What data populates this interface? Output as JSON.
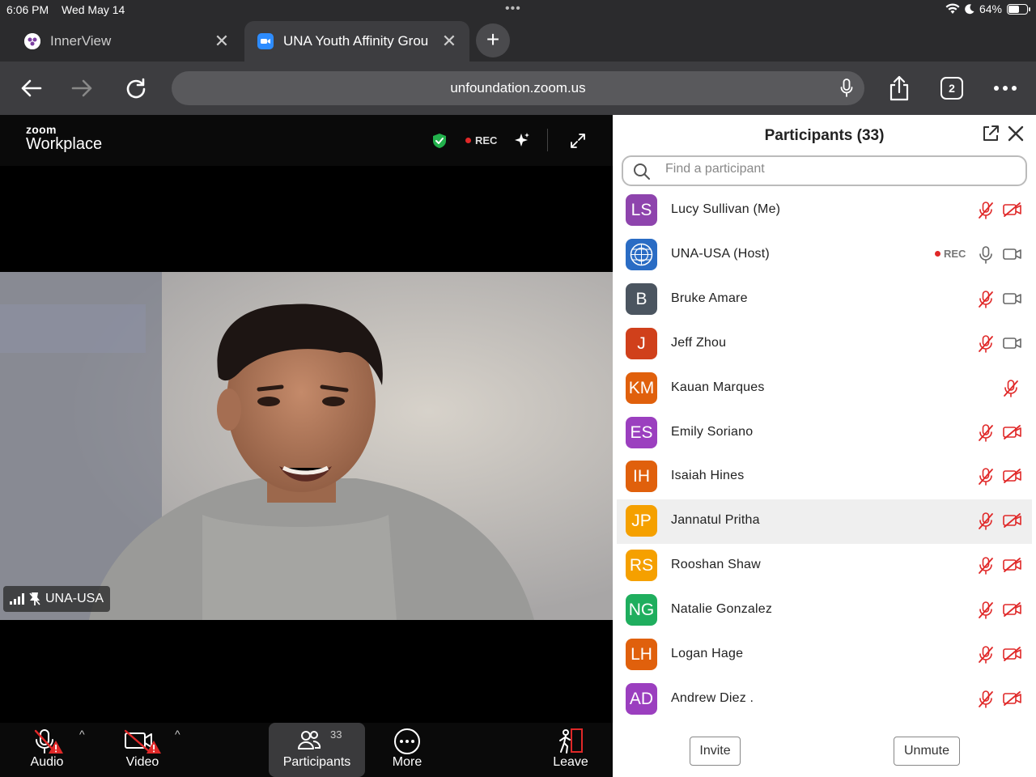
{
  "status_bar": {
    "time": "6:06 PM",
    "date": "Wed May 14",
    "battery": "64%",
    "battery_level": 0.64
  },
  "tabs": [
    {
      "title": "InnerView",
      "active": false
    },
    {
      "title": "UNA Youth Affinity Grou",
      "active": true
    }
  ],
  "toolbar": {
    "url": "unfoundation.zoom.us",
    "tab_count": "2"
  },
  "zoom": {
    "logo_small": "zoom",
    "logo_big": "Workplace",
    "rec_label": "REC",
    "speaker_name": "UNA-USA",
    "controls": {
      "audio": "Audio",
      "video": "Video",
      "participants": "Participants",
      "participants_count": "33",
      "more": "More",
      "leave": "Leave"
    }
  },
  "panel": {
    "title": "Participants (33)",
    "search_placeholder": "Find a participant",
    "invite": "Invite",
    "unmute": "Unmute",
    "rec_label": "REC",
    "participants": [
      {
        "initials": "LS",
        "name": "Lucy Sullivan (Me)",
        "color": "#8e44ad",
        "mic": "muted",
        "cam": "off"
      },
      {
        "initials": "",
        "name": "UNA-USA (Host)",
        "color": "#2a6cc4",
        "mic": "on",
        "cam": "on",
        "rec": true,
        "logo": true
      },
      {
        "initials": "B",
        "name": "Bruke Amare",
        "color": "#4b5560",
        "mic": "muted",
        "cam": "on"
      },
      {
        "initials": "J",
        "name": "Jeff Zhou",
        "color": "#d0401b",
        "mic": "muted",
        "cam": "on"
      },
      {
        "initials": "KM",
        "name": "Kauan Marques",
        "color": "#e0600c",
        "mic": "muted",
        "cam": "none"
      },
      {
        "initials": "ES",
        "name": "Emily Soriano",
        "color": "#9b3fbf",
        "mic": "muted",
        "cam": "off"
      },
      {
        "initials": "IH",
        "name": "Isaiah Hines",
        "color": "#e0600c",
        "mic": "muted",
        "cam": "off"
      },
      {
        "initials": "JP",
        "name": "Jannatul Pritha",
        "color": "#f5a000",
        "mic": "muted",
        "cam": "off",
        "highlight": true
      },
      {
        "initials": "RS",
        "name": "Rooshan Shaw",
        "color": "#f5a000",
        "mic": "muted",
        "cam": "off"
      },
      {
        "initials": "NG",
        "name": "Natalie Gonzalez",
        "color": "#1fae5e",
        "mic": "muted",
        "cam": "off"
      },
      {
        "initials": "LH",
        "name": "Logan Hage",
        "color": "#e0600c",
        "mic": "muted",
        "cam": "off"
      },
      {
        "initials": "AD",
        "name": "Andrew Diez .",
        "color": "#9b3fbf",
        "mic": "muted",
        "cam": "off"
      }
    ]
  },
  "icons": {
    "shield": "shield-check-icon",
    "sparkle": "sparkle-icon",
    "expand": "expand-icon",
    "signal": "signal-bars-icon",
    "pin": "pin-icon"
  },
  "colors": {
    "muted_red": "#e02828",
    "accent_blue": "#0b5cff",
    "shield_green": "#22b14c"
  }
}
